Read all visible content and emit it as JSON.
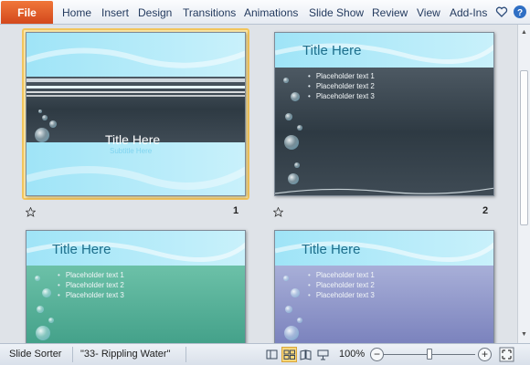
{
  "ribbon": {
    "file_label": "File",
    "tabs": [
      "Home",
      "Insert",
      "Design",
      "Transitions",
      "Animations",
      "Slide Show",
      "Review",
      "View",
      "Add-Ins"
    ]
  },
  "slides": [
    {
      "number": "1",
      "title": "Title Here",
      "subtitle": "Subtitle Here",
      "selected": true
    },
    {
      "number": "2",
      "title": "Title Here",
      "bullets": [
        "Placeholder  text 1",
        "Placeholder  text 2",
        "Placeholder  text 3"
      ]
    },
    {
      "title": "Title Here",
      "bullets": [
        "Placeholder  text 1",
        "Placeholder  text 2",
        "Placeholder  text 3"
      ]
    },
    {
      "title": "Title Here",
      "bullets": [
        "Placeholder  text 1",
        "Placeholder  text 2",
        "Placeholder  text 3"
      ]
    }
  ],
  "status": {
    "view_name": "Slide Sorter",
    "theme": "\"33- Rippling Water\"",
    "zoom": "100%",
    "zoom_level": 0.5
  },
  "colors": {
    "file_tab": "#e05c2a",
    "selection": "#f2c55c",
    "title_text": "#1e6f8c"
  },
  "icons": [
    "heart-icon",
    "help-icon",
    "star-icon",
    "normal-view-icon",
    "slide-sorter-icon",
    "reading-view-icon",
    "slide-show-icon",
    "zoom-out-icon",
    "zoom-in-icon",
    "fit-to-window-icon"
  ]
}
